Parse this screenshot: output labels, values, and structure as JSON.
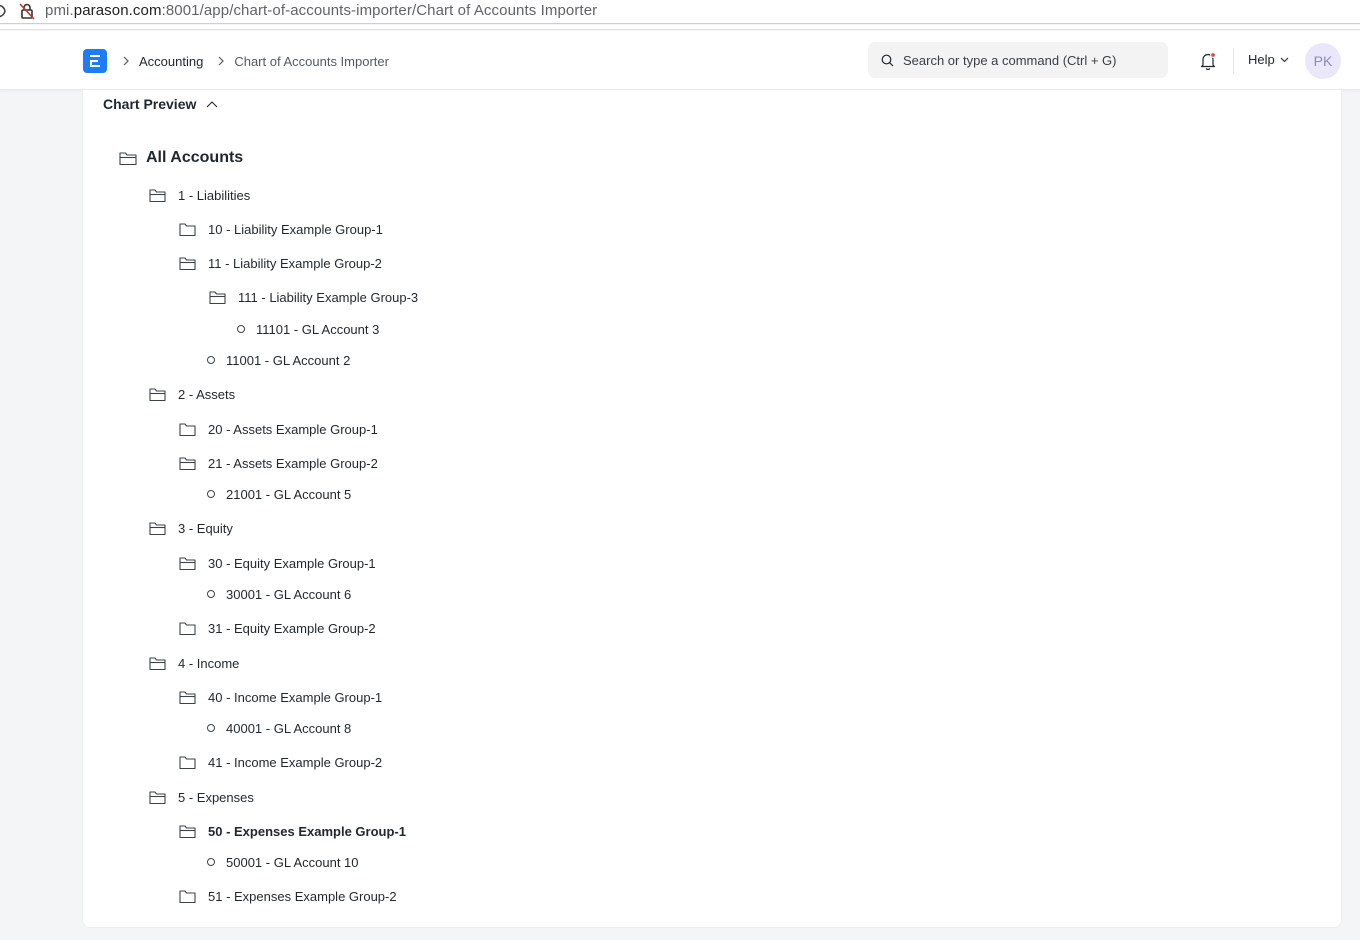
{
  "browser": {
    "url_prefix": "pmi.",
    "url_host": "parason.com",
    "url_rest": ":8001/app/chart-of-accounts-importer/Chart of Accounts Importer"
  },
  "navbar": {
    "logo_letter": "E",
    "breadcrumbs": [
      "Accounting",
      "Chart of Accounts Importer"
    ],
    "search_placeholder": "Search or type a command (Ctrl + G)",
    "help_label": "Help",
    "avatar_initials": "PK",
    "brand_color": "#1f7cf7"
  },
  "section": {
    "title": "Chart Preview"
  },
  "tree": {
    "root": "All Accounts",
    "nodes": [
      {
        "label": "1 - Liabilities",
        "type": "group-open"
      },
      {
        "label": "10 - Liability Example Group-1",
        "type": "group"
      },
      {
        "label": "11 - Liability Example Group-2",
        "type": "group-open"
      },
      {
        "label": "111 - Liability Example Group-3",
        "type": "group-open"
      },
      {
        "label": "11101 - GL Account 3",
        "type": "leaf"
      },
      {
        "label": "11001 - GL Account 2",
        "type": "leaf"
      },
      {
        "label": "2 - Assets",
        "type": "group-open"
      },
      {
        "label": "20 - Assets Example Group-1",
        "type": "group"
      },
      {
        "label": "21 - Assets Example Group-2",
        "type": "group-open"
      },
      {
        "label": "21001 - GL Account 5",
        "type": "leaf"
      },
      {
        "label": "3 - Equity",
        "type": "group-open"
      },
      {
        "label": "30 - Equity Example Group-1",
        "type": "group-open"
      },
      {
        "label": "30001 - GL Account 6",
        "type": "leaf"
      },
      {
        "label": "31 - Equity Example Group-2",
        "type": "group"
      },
      {
        "label": "4 - Income",
        "type": "group-open"
      },
      {
        "label": "40 - Income Example Group-1",
        "type": "group-open"
      },
      {
        "label": "40001 - GL Account 8",
        "type": "leaf"
      },
      {
        "label": "41 - Income Example Group-2",
        "type": "group"
      },
      {
        "label": "5 - Expenses",
        "type": "group-open"
      },
      {
        "label": "50 - Expenses Example Group-1",
        "type": "group-open",
        "selected": true
      },
      {
        "label": "50001 - GL Account 10",
        "type": "leaf"
      },
      {
        "label": "51 - Expenses Example Group-2",
        "type": "group"
      }
    ]
  }
}
